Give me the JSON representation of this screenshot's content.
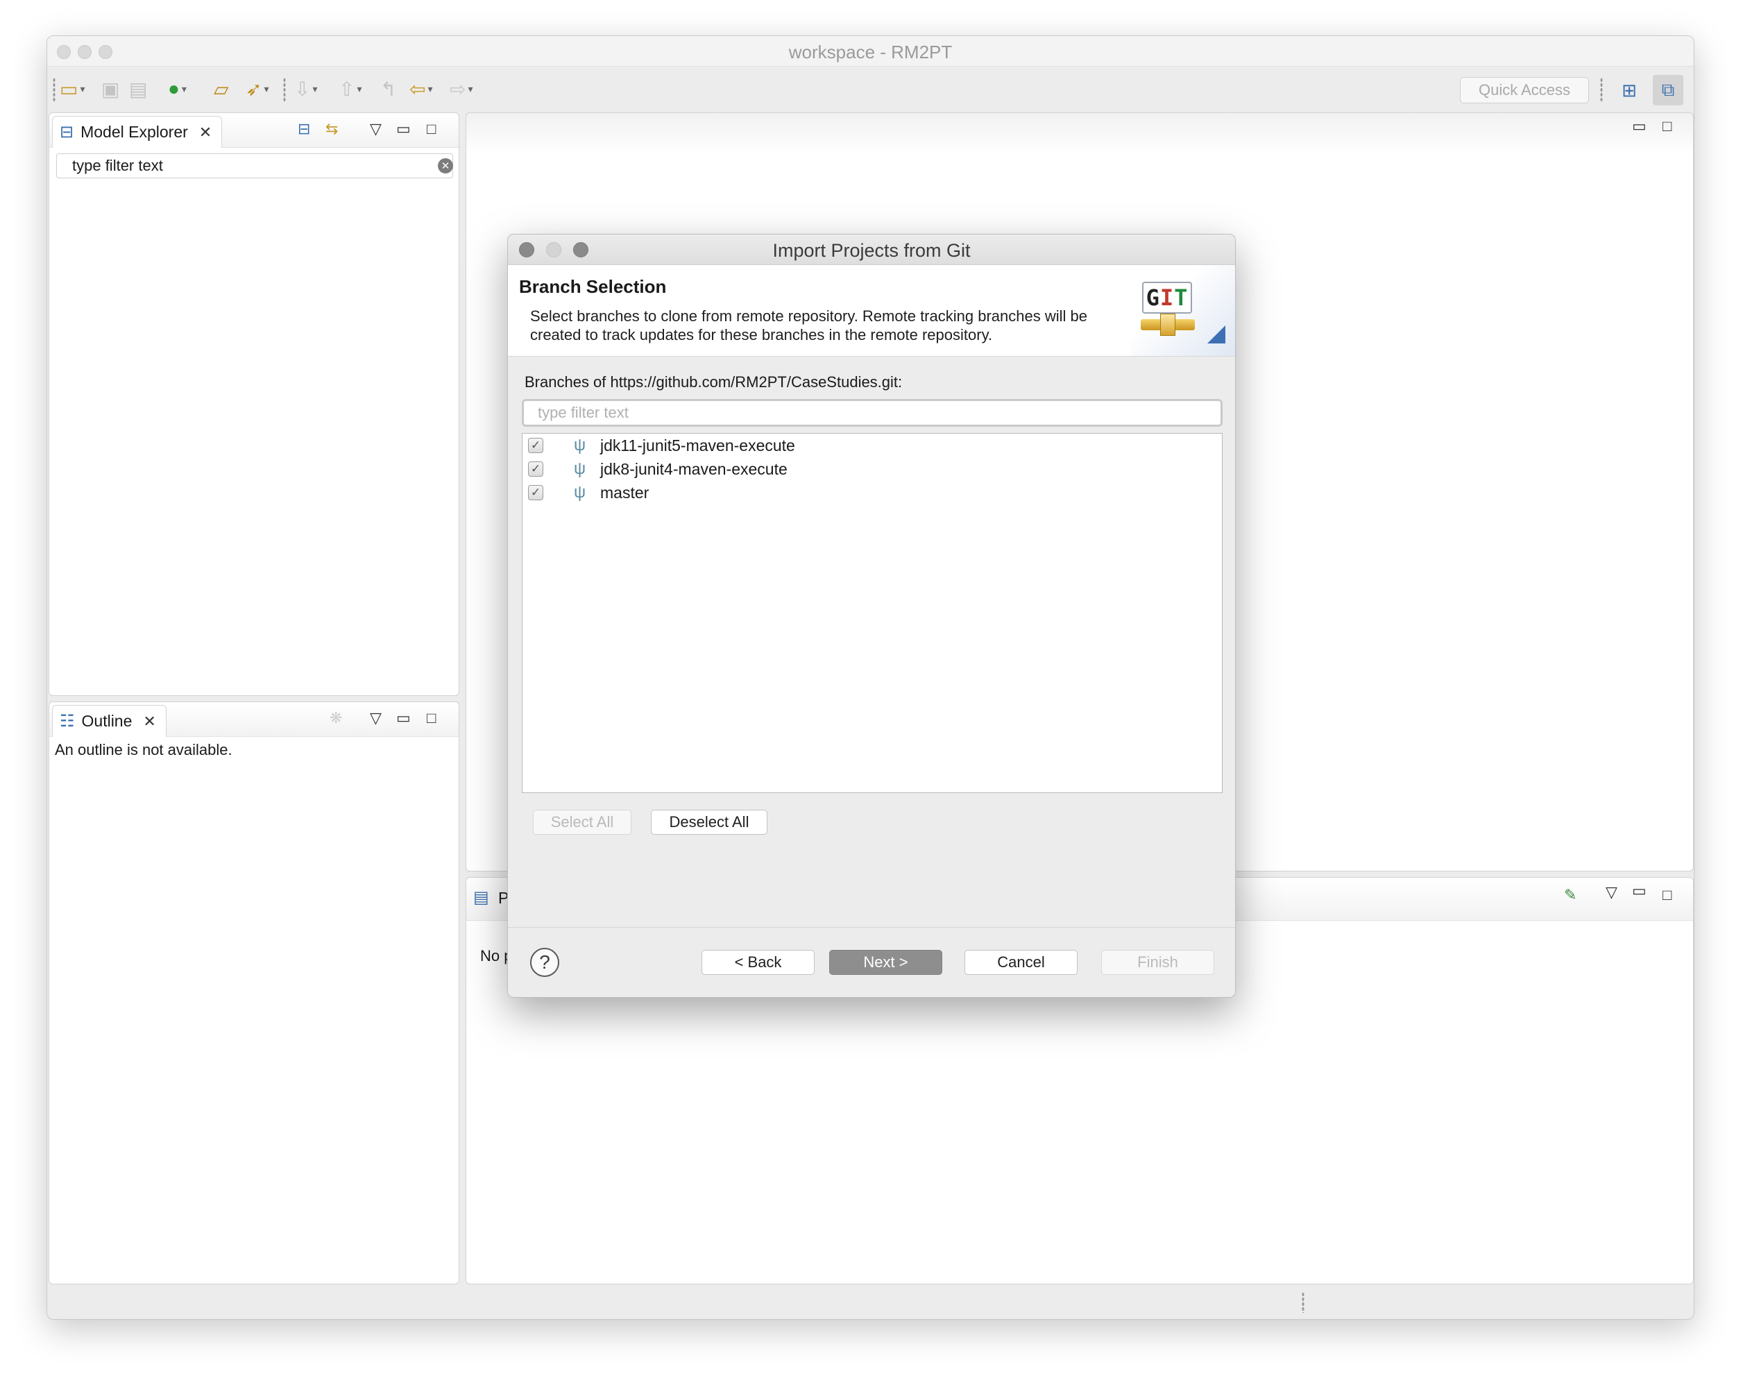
{
  "window": {
    "title": "workspace - RM2PT"
  },
  "toolbar": {
    "quick_access": "Quick Access"
  },
  "model_explorer": {
    "tab_label": "Model Explorer",
    "filter_value": "type filter text"
  },
  "outline": {
    "tab_label": "Outline",
    "message": "An outline is not available."
  },
  "bottom_panel": {
    "tab_label_partial": "P",
    "message_partial": "No p"
  },
  "dialog": {
    "title": "Import Projects from Git",
    "banner_title": "Branch Selection",
    "banner_description": "Select branches to clone from remote repository. Remote tracking branches will be created to track updates for these branches in the remote repository.",
    "logo_text": "GIT",
    "branches_label": "Branches of https://github.com/RM2PT/CaseStudies.git:",
    "filter_placeholder": "type filter text",
    "branches": [
      {
        "name": "jdk11-junit5-maven-execute",
        "checked": true
      },
      {
        "name": "jdk8-junit4-maven-execute",
        "checked": true
      },
      {
        "name": "master",
        "checked": true
      }
    ],
    "select_all": "Select All",
    "deselect_all": "Deselect All",
    "back": "< Back",
    "next": "Next >",
    "cancel": "Cancel",
    "finish": "Finish",
    "help_symbol": "?"
  },
  "icons": {
    "checkmark": "✓",
    "branch": "ψ",
    "close": "✕"
  }
}
